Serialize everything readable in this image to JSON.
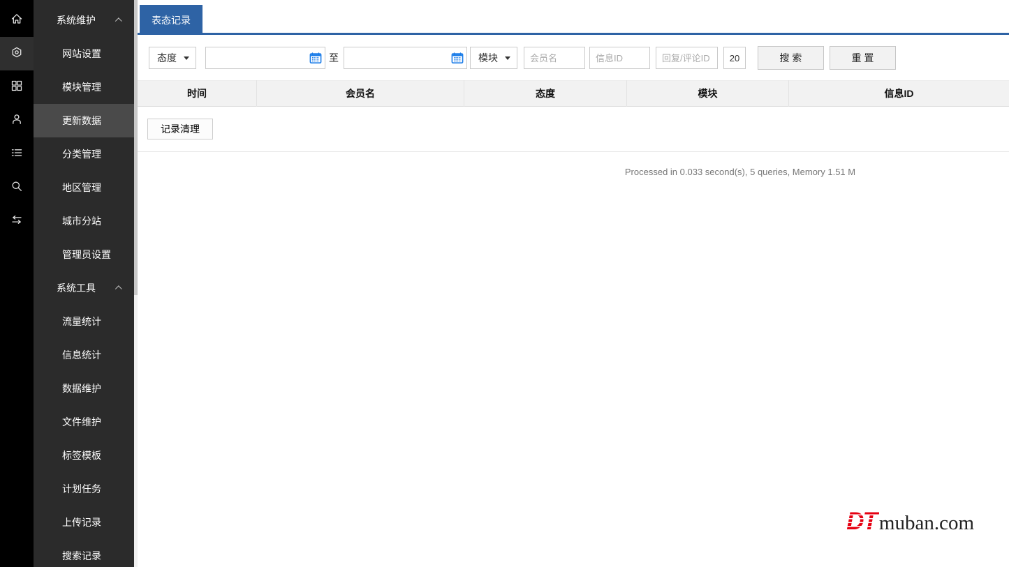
{
  "colors": {
    "accent_blue": "#2e63a5",
    "rail_bg": "#000000",
    "rail_active_bg": "#2f2f2f",
    "sidebar_bg": "#2b2b2b",
    "sidebar_active_bg": "#4a4a4a",
    "header_bg": "#f2f2f2",
    "logo_red": "#e60012",
    "calendar_blue": "#1a7ce8"
  },
  "icon_rail": {
    "items": [
      {
        "name": "home-icon",
        "active": false
      },
      {
        "name": "settings-icon",
        "active": true
      },
      {
        "name": "modules-grid-icon",
        "active": false
      },
      {
        "name": "user-icon",
        "active": false
      },
      {
        "name": "list-icon",
        "active": false
      },
      {
        "name": "search-icon",
        "active": false
      },
      {
        "name": "swap-arrows-icon",
        "active": false
      }
    ]
  },
  "sidebar": {
    "groups": [
      {
        "label": "系统维护",
        "items": [
          {
            "label": "网站设置"
          },
          {
            "label": "模块管理"
          },
          {
            "label": "更新数据",
            "active": true
          },
          {
            "label": "分类管理"
          },
          {
            "label": "地区管理"
          },
          {
            "label": "城市分站"
          },
          {
            "label": "管理员设置"
          }
        ]
      },
      {
        "label": "系统工具",
        "items": [
          {
            "label": "流量统计"
          },
          {
            "label": "信息统计"
          },
          {
            "label": "数据维护"
          },
          {
            "label": "文件维护"
          },
          {
            "label": "标签模板"
          },
          {
            "label": "计划任务"
          },
          {
            "label": "上传记录"
          },
          {
            "label": "搜索记录"
          }
        ]
      }
    ]
  },
  "tabs": {
    "active": "表态记录"
  },
  "filter": {
    "attitude_select": "态度",
    "date_from": "",
    "to_label": "至",
    "date_to": "",
    "module_select": "模块",
    "member_placeholder": "会员名",
    "itemid_placeholder": "信息ID",
    "replyid_placeholder": "回复/评论ID",
    "pagesize": "20",
    "search_label": "搜 索",
    "reset_label": "重 置"
  },
  "table": {
    "columns": [
      "时间",
      "会员名",
      "态度",
      "模块",
      "信息ID"
    ],
    "rows": []
  },
  "actions": {
    "clear_label": "记录清理"
  },
  "status": {
    "processed": "Processed in 0.033 second(s), 5 queries, Memory 1.51 M"
  },
  "watermark": {
    "dt": "DT",
    "domain": "muban.com"
  }
}
